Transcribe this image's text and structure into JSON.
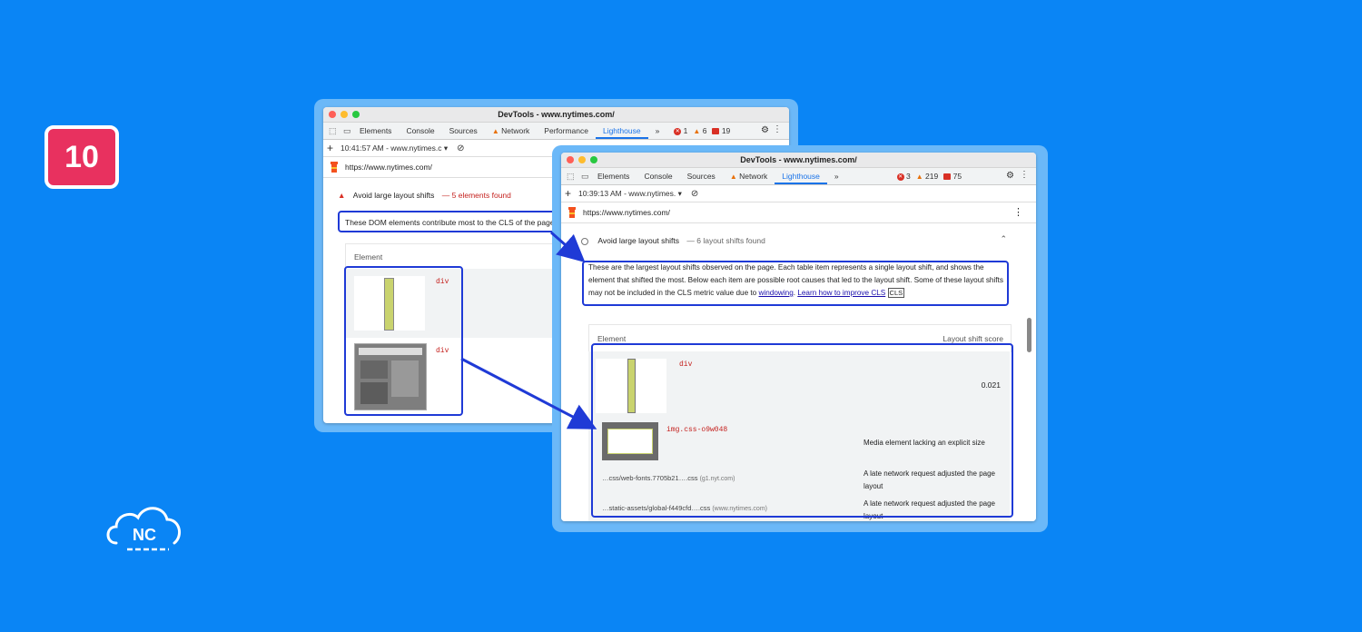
{
  "step_badge": "10",
  "logo_text": "NC",
  "back_window": {
    "title": "DevTools - www.nytimes.com/",
    "tabs": [
      "Elements",
      "Console",
      "Sources",
      "Network",
      "Performance",
      "Lighthouse"
    ],
    "active_tab": "Lighthouse",
    "more_tabs": "»",
    "counts": {
      "errors": "1",
      "warnings": "6",
      "messages": "19"
    },
    "toolbar_report": "10:41:57 AM - www.nytimes.c",
    "url": "https://www.nytimes.com/",
    "audit_title": "Avoid large layout shifts",
    "audit_detail": "— 5 elements found",
    "description": "These DOM elements contribute most to the CLS of the page.",
    "table_header": "Element",
    "rows": [
      {
        "tag": "div"
      },
      {
        "tag": "div"
      }
    ]
  },
  "front_window": {
    "title": "DevTools - www.nytimes.com/",
    "tabs": [
      "Elements",
      "Console",
      "Sources",
      "Network",
      "Lighthouse"
    ],
    "active_tab": "Lighthouse",
    "more_tabs": "»",
    "counts": {
      "errors": "3",
      "warnings": "219",
      "messages": "75"
    },
    "toolbar_report": "10:39:13 AM - www.nytimes.",
    "url": "https://www.nytimes.com/",
    "audit_title": "Avoid large layout shifts",
    "audit_detail": "— 6 layout shifts found",
    "description_text": "These are the largest layout shifts observed on the page. Each table item represents a single layout shift, and shows the element that shifted the most. Below each item are possible root causes that led to the layout shift. Some of these layout shifts may not be included in the CLS metric value due to ",
    "link_windowing": "windowing",
    "link_learn": "Learn how to improve CLS",
    "cls_badge": "CLS",
    "col_element": "Element",
    "col_score": "Layout shift score",
    "item_tag": "div",
    "item_score": "0.021",
    "sub_img_tag": "img.css-o9w048",
    "sub_img_reason": "Media element lacking an explicit size",
    "causes": [
      {
        "file": "…css/web-fonts.7705b21….css",
        "host": "(g1.nyt.com)",
        "reason": "A late network request adjusted the page layout"
      },
      {
        "file": "…static-assets/global-f449cfd….css",
        "host": "(www.nytimes.com)",
        "reason": "A late network request adjusted the page layout"
      }
    ]
  },
  "colors": {
    "background": "#0a85f5",
    "highlight": "#1f3ad6",
    "badge": "#e8315f",
    "active_tab": "#1a73e8"
  }
}
